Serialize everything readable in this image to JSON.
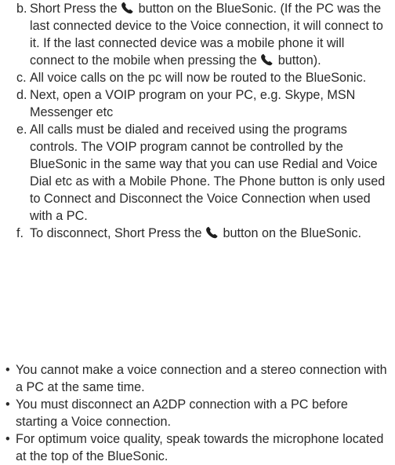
{
  "icons": {
    "phone": "phone-icon",
    "bullet": "•"
  },
  "steps": [
    {
      "letter": "b.",
      "parts": [
        "Short Press the ",
        " button on the BlueSonic. (If the PC was the last connected device to the Voice connection, it will connect to it. If the last connected device was a mobile phone it will connect to the mobile when pressing the ",
        " button)."
      ]
    },
    {
      "letter": "c.",
      "text": "All voice calls on the pc will now be routed to the BlueSonic."
    },
    {
      "letter": "d.",
      "text": "Next, open a VOIP program on your PC, e.g. Skype, MSN Messenger etc"
    },
    {
      "letter": "e.",
      "text": "All calls must be dialed and received using the programs controls. The VOIP program cannot be controlled by the BlueSonic in the same way that you can use Redial and Voice Dial etc as with a Mobile Phone. The Phone button is only used to Connect and Disconnect the Voice Connection when used with a PC."
    },
    {
      "letter": "f.",
      "parts": [
        "To disconnect, Short Press the ",
        " button on the BlueSonic."
      ]
    }
  ],
  "notes": [
    "You cannot make a voice connection and a stereo connection with a PC at the same time.",
    "You must disconnect an A2DP connection with a PC before starting a Voice connection.",
    "For optimum voice quality, speak towards the microphone located at the top of the BlueSonic."
  ]
}
